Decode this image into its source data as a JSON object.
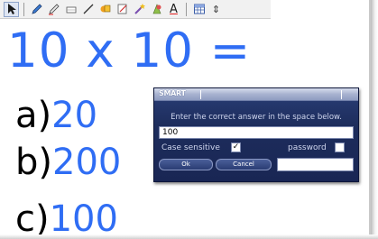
{
  "toolbar": {
    "tools": [
      {
        "name": "select-arrow-icon"
      },
      {
        "name": "pen-icon"
      },
      {
        "name": "creative-pen-icon"
      },
      {
        "name": "eraser-icon"
      },
      {
        "name": "line-icon"
      },
      {
        "name": "fill-icon"
      },
      {
        "name": "properties-icon"
      },
      {
        "name": "magic-pen-icon"
      },
      {
        "name": "shape-recognition-icon"
      },
      {
        "name": "text-icon"
      },
      {
        "name": "table-icon"
      },
      {
        "name": "more-tools-icon"
      }
    ],
    "text_tool_glyph": "A",
    "more_glyph": "⇕"
  },
  "lesson": {
    "question": "10 x 10 =",
    "answers": [
      {
        "label": "a)",
        "value": "20"
      },
      {
        "label": "b)",
        "value": "200"
      },
      {
        "label": "c)",
        "value": "100"
      }
    ]
  },
  "dialog": {
    "logo": "SMART",
    "prompt": "Enter the correct answer in the space below.",
    "answer_value": "100",
    "case_sensitive_label": "Case sensitive",
    "case_sensitive_checked": "✓",
    "password_label": "password",
    "ok_label": "Ok",
    "cancel_label": "Cancel"
  },
  "colors": {
    "accent": "#2f6df4",
    "dialog_bg": "#1d2d5c"
  }
}
